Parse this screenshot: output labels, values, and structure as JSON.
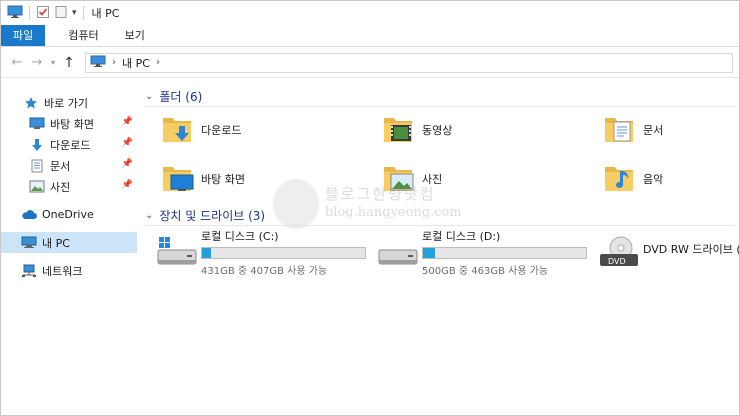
{
  "window": {
    "title": "내 PC"
  },
  "ribbon": {
    "tabs": [
      {
        "label": "파일"
      },
      {
        "label": "컴퓨터"
      },
      {
        "label": "보기"
      }
    ]
  },
  "address": {
    "breadcrumb": [
      "내 PC"
    ]
  },
  "nav": {
    "quick_access": "바로 가기",
    "items": [
      {
        "label": "바탕 화면",
        "icon": "desktop-icon",
        "pinned": true
      },
      {
        "label": "다운로드",
        "icon": "download-arrow-icon",
        "pinned": true
      },
      {
        "label": "문서",
        "icon": "document-icon",
        "pinned": true
      },
      {
        "label": "사진",
        "icon": "pictures-icon",
        "pinned": true
      }
    ],
    "onedrive": "OneDrive",
    "this_pc": "내 PC",
    "network": "네트워크"
  },
  "folders": {
    "header": "폴더 (6)",
    "items": [
      {
        "label": "다운로드",
        "icon": "downloads-folder-icon"
      },
      {
        "label": "동영상",
        "icon": "videos-folder-icon"
      },
      {
        "label": "문서",
        "icon": "documents-folder-icon"
      },
      {
        "label": "바탕 화면",
        "icon": "desktop-folder-icon"
      },
      {
        "label": "사진",
        "icon": "pictures-folder-icon"
      },
      {
        "label": "음악",
        "icon": "music-folder-icon"
      }
    ]
  },
  "drives": {
    "header": "장치 및 드라이브 (3)",
    "items": [
      {
        "name": "로컬 디스크 (C:)",
        "free": "431GB 중 407GB 사용 가능",
        "used_fraction": 0.056
      },
      {
        "name": "로컬 디스크 (D:)",
        "free": "500GB 중 463GB 사용 가능",
        "used_fraction": 0.074
      },
      {
        "name": "DVD RW 드라이브 (",
        "free": "",
        "used_fraction": null
      }
    ]
  },
  "watermark": {
    "title": "블로그한량닷컴",
    "url": "blog.hangyeong.com"
  },
  "colors": {
    "accent": "#1979ca",
    "selection": "#cce4f7",
    "group_header": "#1e3287",
    "bar_fill": "#26a0da"
  }
}
